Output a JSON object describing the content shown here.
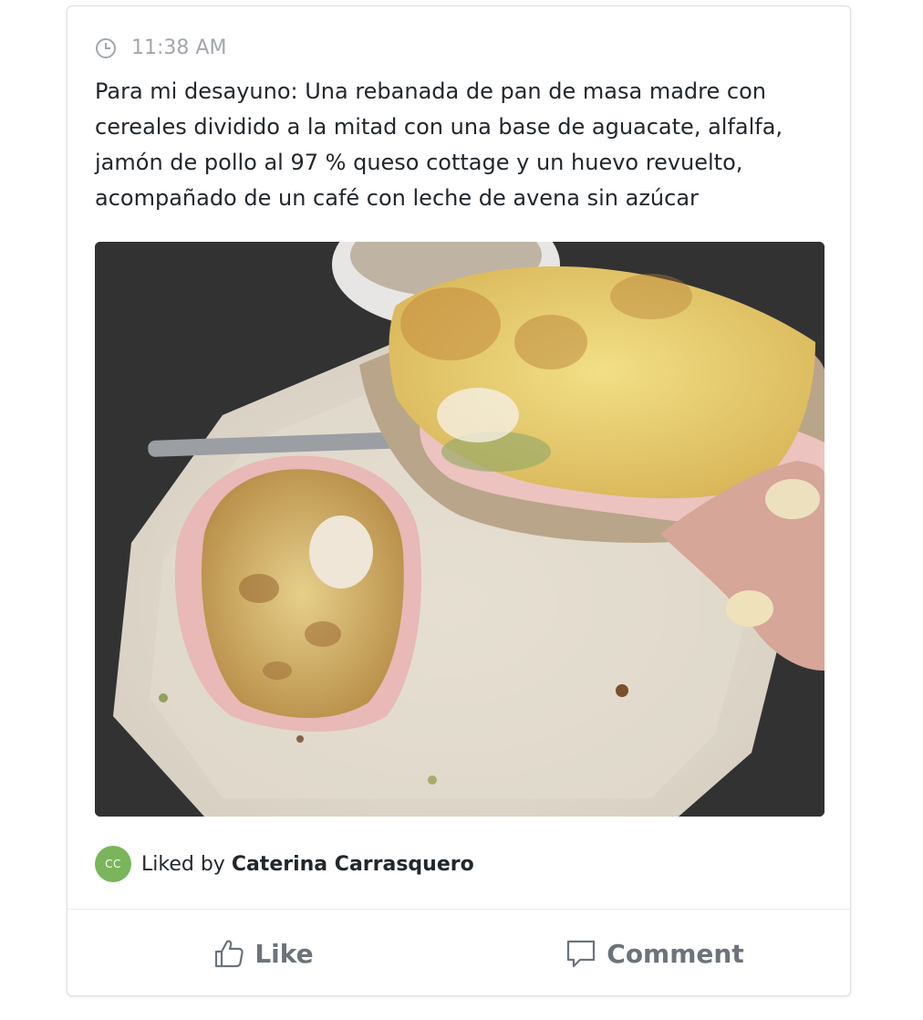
{
  "post": {
    "time": "11:38 AM",
    "text": "Para mi desayuno: Una rebanada de pan de masa madre con cereales dividido a la mitad con una base de aguacate, alfalfa, jamón de pollo al 97 % queso cottage y un huevo revuelto, acompañado de un café con leche de avena sin azúcar"
  },
  "likes": {
    "avatar_initials": "CC",
    "prefix": "Liked by",
    "name": "Caterina Carrasquero"
  },
  "actions": {
    "like_label": "Like",
    "comment_label": "Comment"
  },
  "icons": {
    "time": "clock-icon",
    "like": "thumbs-up-icon",
    "comment": "speech-bubble-icon"
  },
  "colors": {
    "avatar_bg": "#7ab55c",
    "muted_text": "#a2a7ad",
    "action_text": "#6c737a"
  }
}
